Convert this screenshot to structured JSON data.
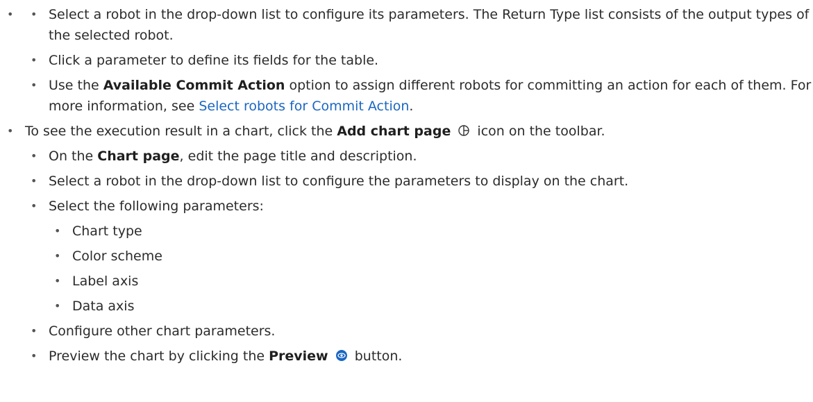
{
  "items": {
    "robot_select": "Select a robot in the drop-down list to configure its parameters. The Return Type list consists of the output types of the selected robot.",
    "click_param": "Click a parameter to define its fields for the table.",
    "commit_pre": "Use the ",
    "commit_bold": "Available Commit Action",
    "commit_mid": " option to assign different robots for committing an action for each of them. For more information, see ",
    "commit_link": "Select robots for Commit Action",
    "commit_end": ".",
    "chart_pre": "To see the execution result in a chart, click the ",
    "chart_bold": "Add chart page",
    "chart_post": " icon on the toolbar.",
    "chartpage_pre": "On the ",
    "chartpage_bold": "Chart page",
    "chartpage_post": ", edit the page title and description.",
    "robot_chart": "Select a robot in the drop-down list to configure the parameters to display on the chart.",
    "params_intro": "Select the following parameters:",
    "params": [
      "Chart type",
      "Color scheme",
      "Label axis",
      "Data axis"
    ],
    "configure_other": "Configure other chart parameters.",
    "preview_pre": "Preview the chart by clicking the ",
    "preview_bold": "Preview",
    "preview_post": " button."
  },
  "icons": {
    "add_chart": "add-chart-page-icon",
    "preview": "preview-eye-icon"
  },
  "colors": {
    "link": "#1a66c2",
    "preview_icon": "#1a66c2"
  }
}
